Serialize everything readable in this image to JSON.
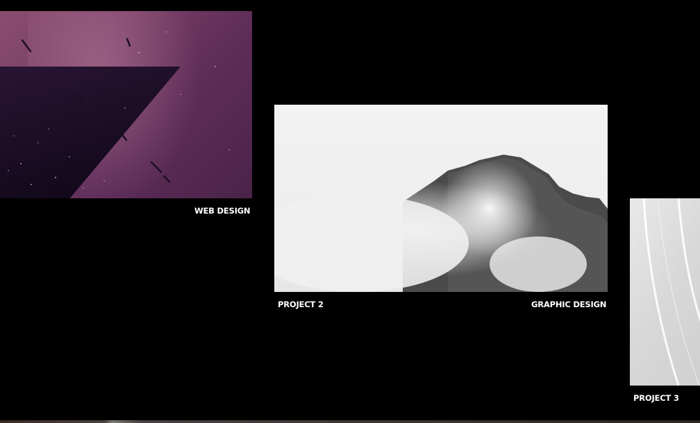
{
  "projects": [
    {
      "title": "",
      "category": "WEB DESIGN",
      "image": "purple-nebula-image"
    },
    {
      "title": "PROJECT 2",
      "category": "GRAPHIC DESIGN",
      "image": "foggy-mountain-image"
    },
    {
      "title": "PROJECT 3",
      "category": "",
      "image": "white-abstract-curves-image"
    }
  ],
  "colors": {
    "background": "#000000",
    "caption_text": "#ffffff"
  }
}
